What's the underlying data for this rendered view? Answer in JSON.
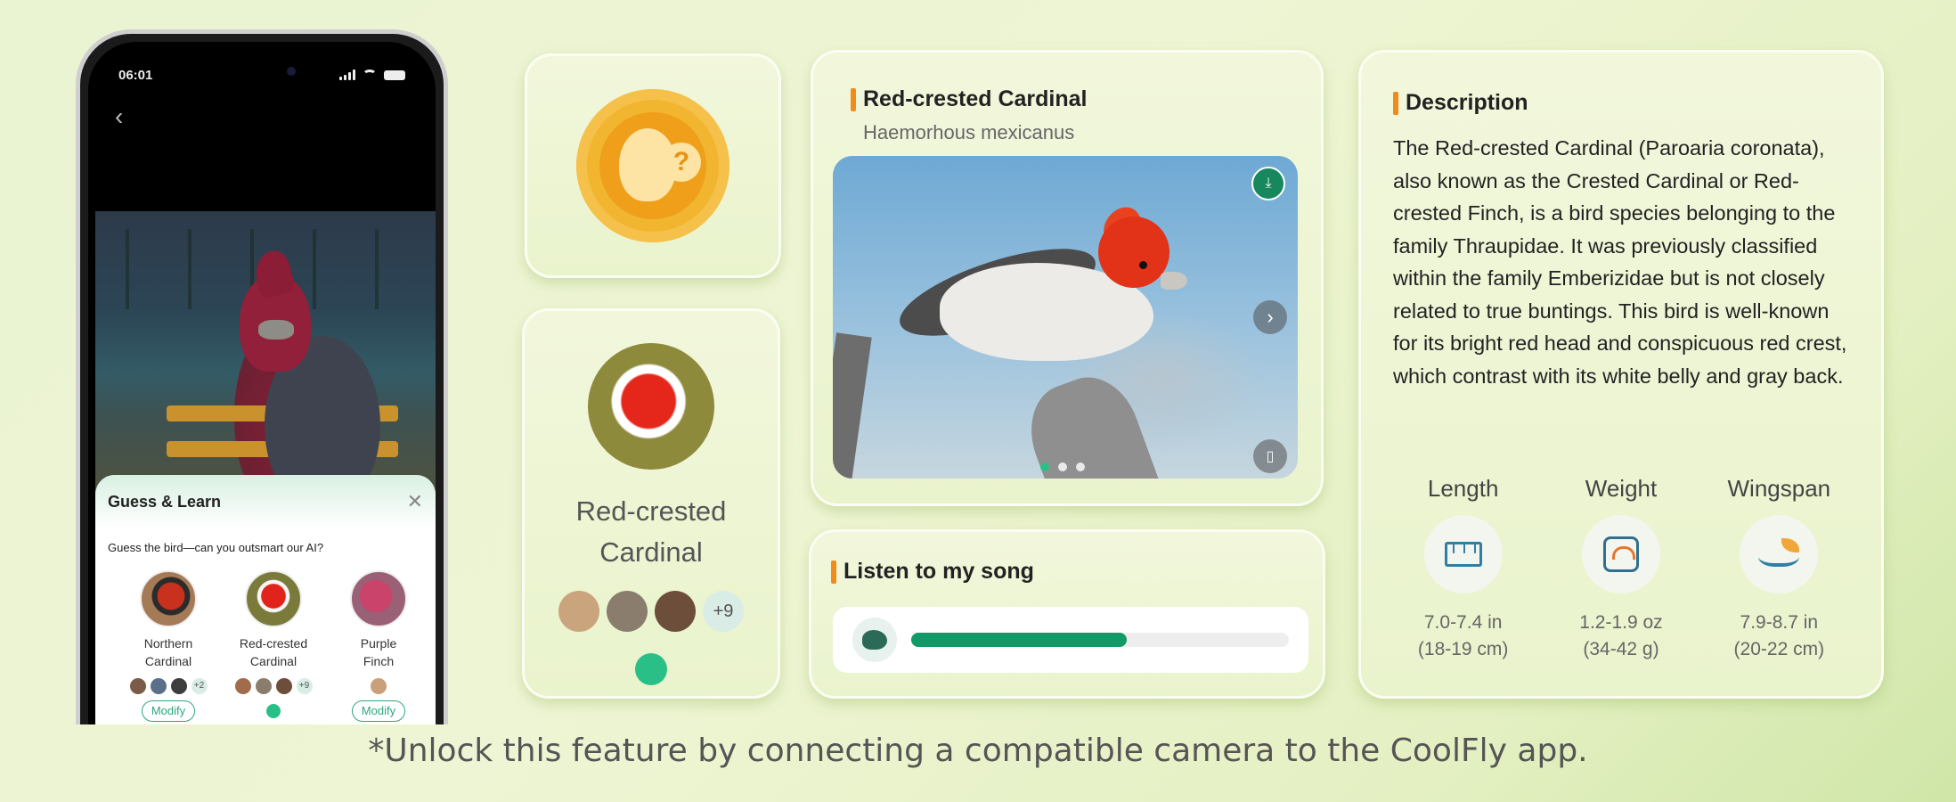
{
  "phone": {
    "status_time": "06:01",
    "back_icon": "chevron-left-icon",
    "favorite_icon": "heart-icon",
    "sheet": {
      "title": "Guess & Learn",
      "close_icon": "close-icon",
      "question": "Guess the bird—can you outsmart our AI?",
      "choices": [
        {
          "name_line1": "Northern",
          "name_line2": "Cardinal",
          "extra_count": "+2",
          "action": "Modify"
        },
        {
          "name_line1": "Red-crested",
          "name_line2": "Cardinal",
          "extra_count": "+9",
          "selected": true
        },
        {
          "name_line1": "Purple",
          "name_line2": "Finch",
          "action": "Modify"
        }
      ]
    }
  },
  "profile": {
    "name_line1": "Red-crested",
    "name_line2": "Cardinal",
    "extra_count": "+9"
  },
  "photo_card": {
    "title": "Red-crested Cardinal",
    "scientific_name": "Haemorhous mexicanus",
    "page_count": 3,
    "active_page": 1
  },
  "song": {
    "title": "Listen to my song",
    "progress": 0.57
  },
  "description": {
    "title": "Description",
    "text": "The Red-crested Cardinal (Paroaria coronata), also known as the Crested Cardinal or Red-crested Finch, is a bird species belonging to the family Thraupidae. It was previously classified within the family Emberizidae but is not closely related to true buntings. This bird is well-known for its bright red head and conspicuous red crest, which contrast with its white belly and gray back.",
    "stats": [
      {
        "label": "Length",
        "icon": "ruler-icon",
        "value1": "7.0-7.4 in",
        "value2": "(18-19 cm)"
      },
      {
        "label": "Weight",
        "icon": "scale-icon",
        "value1": "1.2-1.9 oz",
        "value2": "(34-42 g)"
      },
      {
        "label": "Wingspan",
        "icon": "wingspan-icon",
        "value1": "7.9-8.7 in",
        "value2": "(20-22 cm)"
      }
    ]
  },
  "footnote": "*Unlock this feature by connecting a compatible camera to the CoolFly app.",
  "colors": {
    "accent_green": "#2bbf88",
    "accent_orange": "#f08c1a",
    "progress": "#119a67"
  }
}
